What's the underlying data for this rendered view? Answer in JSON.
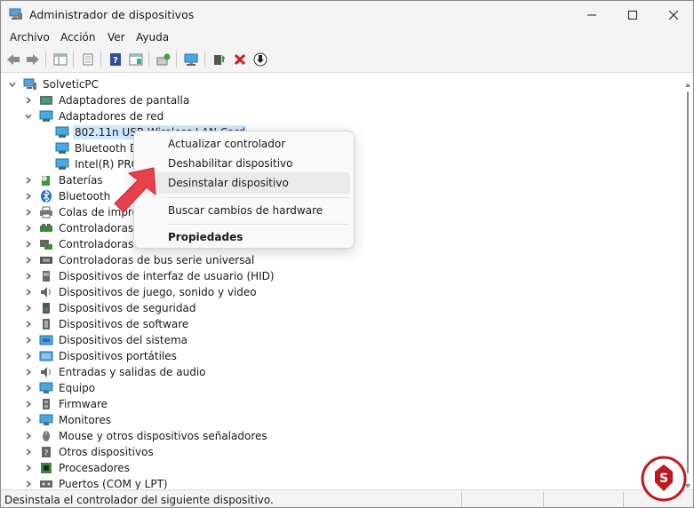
{
  "window": {
    "title": "Administrador de dispositivos"
  },
  "menu": [
    "Archivo",
    "Acción",
    "Ver",
    "Ayuda"
  ],
  "tree": {
    "root": "SolveticPC",
    "items": [
      {
        "label": "Adaptadores de pantalla",
        "expanded": false,
        "icon": "display-adapter-icon"
      },
      {
        "label": "Adaptadores de red",
        "expanded": true,
        "icon": "network-adapter-icon",
        "children": [
          {
            "label": "802.11n USB Wireless LAN Card",
            "selected": true
          },
          {
            "label": "Bluetooth De"
          },
          {
            "label": "Intel(R) PRO/"
          }
        ]
      },
      {
        "label": "Baterías",
        "icon": "battery-icon"
      },
      {
        "label": "Bluetooth",
        "icon": "bluetooth-icon"
      },
      {
        "label": "Colas de impres",
        "icon": "printer-icon"
      },
      {
        "label": "Controladoras A",
        "icon": "controller-icon"
      },
      {
        "label": "Controladoras d",
        "icon": "storage-controller-icon"
      },
      {
        "label": "Controladoras de bus serie universal",
        "icon": "usb-icon"
      },
      {
        "label": "Dispositivos de interfaz de usuario (HID)",
        "icon": "hid-icon"
      },
      {
        "label": "Dispositivos de juego, sonido y video",
        "icon": "sound-icon"
      },
      {
        "label": "Dispositivos de seguridad",
        "icon": "security-icon"
      },
      {
        "label": "Dispositivos de software",
        "icon": "software-icon"
      },
      {
        "label": "Dispositivos del sistema",
        "icon": "system-icon"
      },
      {
        "label": "Dispositivos portátiles",
        "icon": "portable-icon"
      },
      {
        "label": "Entradas y salidas de audio",
        "icon": "audio-icon"
      },
      {
        "label": "Equipo",
        "icon": "computer-icon"
      },
      {
        "label": "Firmware",
        "icon": "firmware-icon"
      },
      {
        "label": "Monitores",
        "icon": "monitor-icon"
      },
      {
        "label": "Mouse y otros dispositivos señaladores",
        "icon": "mouse-icon"
      },
      {
        "label": "Otros dispositivos",
        "icon": "other-devices-icon"
      },
      {
        "label": "Procesadores",
        "icon": "processor-icon"
      },
      {
        "label": "Puertos (COM y LPT)",
        "icon": "ports-icon"
      }
    ]
  },
  "context_menu": {
    "items": [
      {
        "label": "Actualizar controlador"
      },
      {
        "label": "Deshabilitar dispositivo"
      },
      {
        "label": "Desinstalar dispositivo",
        "hover": true
      },
      {
        "label": "Buscar cambios de hardware"
      },
      {
        "label": "Propiedades",
        "bold": true
      }
    ]
  },
  "status": {
    "text": "Desinstala el controlador del siguiente dispositivo."
  },
  "colors": {
    "accent": "#0067c0",
    "selection": "#cde8ff",
    "arrow": "#e8404a",
    "logo": "#c3171f"
  }
}
